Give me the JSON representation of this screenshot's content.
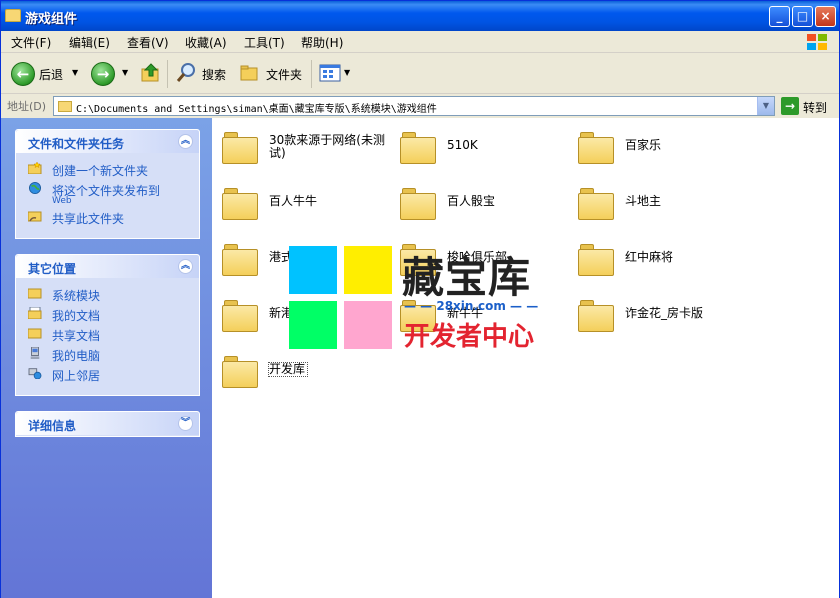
{
  "window": {
    "title": "游戏组件",
    "minimize": "_",
    "maximize": "□",
    "close": "×"
  },
  "menu": [
    "文件(F)",
    "编辑(E)",
    "查看(V)",
    "收藏(A)",
    "工具(T)",
    "帮助(H)"
  ],
  "toolbar": {
    "back": "后退",
    "search": "搜索",
    "folders": "文件夹"
  },
  "address": {
    "label": "地址(D)",
    "path": "C:\\Documents and Settings\\siman\\桌面\\藏宝库专版\\系统模块\\游戏组件",
    "go": "转到"
  },
  "panels": {
    "tasks": {
      "title": "文件和文件夹任务",
      "items": [
        "创建一个新文件夹",
        "将这个文件夹发布到",
        "共享此文件夹"
      ],
      "publish_sub": "Web"
    },
    "places": {
      "title": "其它位置",
      "items": [
        "系统模块",
        "我的文档",
        "共享文档",
        "我的电脑",
        "网上邻居"
      ]
    },
    "details": {
      "title": "详细信息"
    }
  },
  "folders": [
    "30款来源于网络(未测试)",
    "510K",
    "百家乐",
    "百人牛牛",
    "百人骰宝",
    "斗地主",
    "港式",
    "梭哈俱乐部",
    "红中麻将",
    "新港",
    "新牛牛",
    "诈金花_房卡版",
    "开发库"
  ],
  "watermark": {
    "brand": "藏宝库",
    "url": "28xin.com",
    "slogan": "开发者中心"
  },
  "colors": {
    "titlebar": "#0054e3",
    "taskpane_top": "#7ba2e7",
    "taskpane_bottom": "#6375d6",
    "link": "#215dc6",
    "wm_cyan": "#00c2ff",
    "wm_yellow": "#ffee00",
    "wm_green": "#00ff66",
    "wm_pink": "#ffa6cf"
  }
}
